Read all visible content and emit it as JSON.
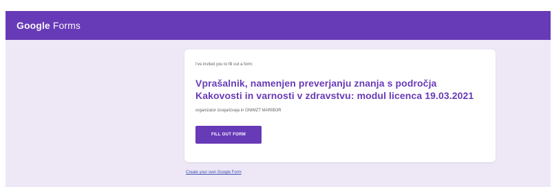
{
  "app": {
    "name": "Google Forms",
    "brand_part_1": "Google",
    "brand_part_2": " Forms"
  },
  "card": {
    "invite_text": "I've invited you to fill out a form:",
    "title": "Vprašalnik, namenjen preverjanju znanja s področja Kakovosti in varnosti v zdravstvu: modul licenca 19.03.2021",
    "organizer_text": "organizator izvaja/izvaja in ONIMZT MARIBOR",
    "button_label": "FILL OUT FORM"
  },
  "footer": {
    "create_link": "Create your own Google Form"
  },
  "colors": {
    "primary": "#673ab7",
    "page_background": "#ede7f6",
    "card_background": "#ffffff",
    "link": "#3f51b5"
  }
}
